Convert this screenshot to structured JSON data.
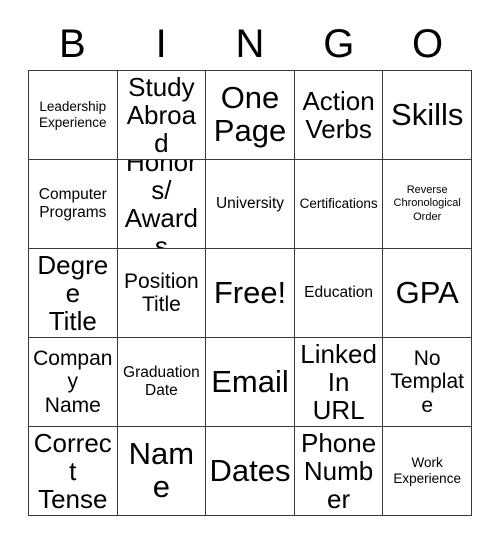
{
  "card": {
    "title_letters": [
      "B",
      "I",
      "N",
      "G",
      "O"
    ],
    "background_color": "#ffffff",
    "text_color": "#000000",
    "border_color": "#3a3a3a",
    "columns": 5,
    "rows": 5
  },
  "grid": {
    "cells": [
      {
        "text": "Leadership\nExperience",
        "size": "sm",
        "row": 1,
        "col": 1
      },
      {
        "text": "Study\nAbroad",
        "size": "xl",
        "row": 1,
        "col": 2
      },
      {
        "text": "One\nPage",
        "size": "xxl",
        "row": 1,
        "col": 3
      },
      {
        "text": "Action\nVerbs",
        "size": "xl",
        "row": 1,
        "col": 4
      },
      {
        "text": "Skills",
        "size": "xxl",
        "row": 1,
        "col": 5
      },
      {
        "text": "Computer\nPrograms",
        "size": "md",
        "row": 2,
        "col": 1
      },
      {
        "text": "Honors/\nAwards",
        "size": "xl",
        "row": 2,
        "col": 2
      },
      {
        "text": "University",
        "size": "md",
        "row": 2,
        "col": 3
      },
      {
        "text": "Certifications",
        "size": "sm",
        "row": 2,
        "col": 4
      },
      {
        "text": "Reverse\nChronological\nOrder",
        "size": "xs",
        "row": 2,
        "col": 5
      },
      {
        "text": "Degree\nTitle",
        "size": "xl",
        "row": 3,
        "col": 1
      },
      {
        "text": "Position\nTitle",
        "size": "lg",
        "row": 3,
        "col": 2
      },
      {
        "text": "Free!",
        "size": "xxl",
        "row": 3,
        "col": 3
      },
      {
        "text": "Education",
        "size": "md",
        "row": 3,
        "col": 4
      },
      {
        "text": "GPA",
        "size": "xxl",
        "row": 3,
        "col": 5
      },
      {
        "text": "Company\nName",
        "size": "lg",
        "row": 4,
        "col": 1
      },
      {
        "text": "Graduation\nDate",
        "size": "md",
        "row": 4,
        "col": 2
      },
      {
        "text": "Email",
        "size": "xxl",
        "row": 4,
        "col": 3
      },
      {
        "text": "LinkedIn\nURL",
        "size": "xl",
        "row": 4,
        "col": 4
      },
      {
        "text": "No\nTemplate",
        "size": "lg",
        "row": 4,
        "col": 5
      },
      {
        "text": "Correct\nTense",
        "size": "xl",
        "row": 5,
        "col": 1
      },
      {
        "text": "Name",
        "size": "xxl",
        "row": 5,
        "col": 2
      },
      {
        "text": "Dates",
        "size": "xxl",
        "row": 5,
        "col": 3
      },
      {
        "text": "Phone\nNumber",
        "size": "xl",
        "row": 5,
        "col": 4
      },
      {
        "text": "Work\nExperience",
        "size": "sm",
        "row": 5,
        "col": 5
      }
    ]
  }
}
